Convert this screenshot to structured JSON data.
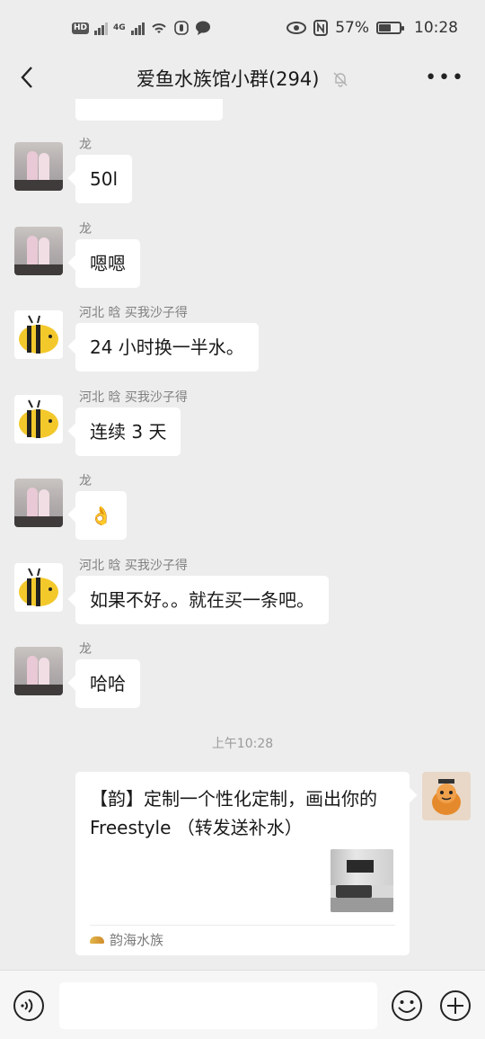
{
  "status_bar": {
    "hd_label": "HD",
    "network_label": "4G",
    "battery": "57%",
    "battery_level": 0.57,
    "time": "10:28"
  },
  "nav": {
    "back_icon": "chevron-left-icon",
    "title": "爱鱼水族馆小群(294)",
    "mute_icon": "bell-off-icon",
    "more_label": "•••"
  },
  "messages": [
    {
      "sender": "龙",
      "text": "50l",
      "avatar": "couple-photo"
    },
    {
      "sender": "龙",
      "text": "嗯嗯",
      "avatar": "couple-photo"
    },
    {
      "sender": "河北 晗 买我沙子得",
      "text": "24 小时换一半水。",
      "avatar": "bee"
    },
    {
      "sender": "河北 晗 买我沙子得",
      "text": "连续 3 天",
      "avatar": "bee"
    },
    {
      "sender": "龙",
      "text": "👌",
      "avatar": "couple-photo"
    },
    {
      "sender": "河北 晗 买我沙子得",
      "text": "如果不好。。就在买一条吧。",
      "avatar": "bee"
    },
    {
      "sender": "龙",
      "text": "哈哈",
      "avatar": "couple-photo"
    }
  ],
  "timestamp": "上午10:28",
  "link_card": {
    "title": "【韵】定制一个性化定制，画出你的Freestyle （转发送补水）",
    "source": "韵海水族"
  },
  "input_bar": {
    "voice_icon": "voice-icon",
    "emoji_icon": "emoji-icon",
    "plus_icon": "plus-icon"
  }
}
